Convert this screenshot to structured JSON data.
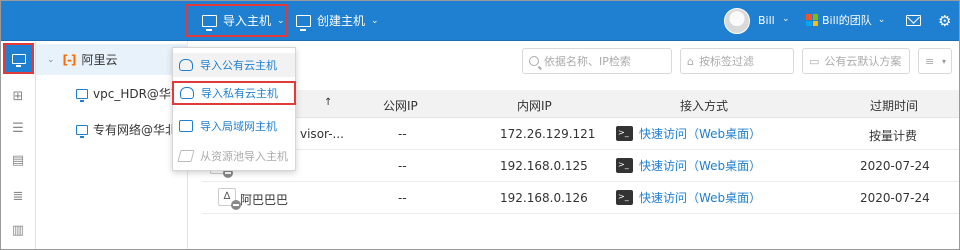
{
  "topbar": {
    "import_label": "导入主机",
    "create_label": "创建主机",
    "user_name": "Bill",
    "team_label": "Bill的团队",
    "brand_color": "#1f7fd0",
    "highlight_color": "#e03a3a"
  },
  "rail": {
    "items": [
      "monitor-icon",
      "topology-icon",
      "database-icon",
      "server-icon",
      "list-icon",
      "clipboard-icon"
    ]
  },
  "tree": {
    "root_label": "阿里云",
    "nodes": [
      "vpc_HDR@华南",
      "专有网络@华北"
    ]
  },
  "filters": {
    "search_placeholder": "依据名称、IP检索",
    "tag_placeholder": "按标签过滤",
    "scheme_value": "公有云默认方案"
  },
  "table": {
    "headers": {
      "name_sort": "↑",
      "public_ip": "公网IP",
      "private_ip": "内网IP",
      "access": "接入方式",
      "expire": "过期时间"
    },
    "rows": [
      {
        "name": "visor-...",
        "public_ip": "--",
        "private_ip": "172.26.129.121",
        "access": "快速访问（Web桌面）",
        "expire": "按量计费"
      },
      {
        "name": "",
        "public_ip": "--",
        "private_ip": "192.168.0.125",
        "access": "快速访问（Web桌面）",
        "expire": "2020-07-24"
      },
      {
        "name": "阿巴巴巴",
        "public_ip": "--",
        "private_ip": "192.168.0.126",
        "access": "快速访问（Web桌面）",
        "expire": "2020-07-24"
      }
    ]
  },
  "menu": {
    "items": [
      {
        "label": "导入公有云主机",
        "state": "hover"
      },
      {
        "label": "导入私有云主机",
        "state": "highlighted"
      },
      {
        "label": "导入局域网主机",
        "state": "normal"
      },
      {
        "label": "从资源池导入主机",
        "state": "disabled"
      }
    ]
  }
}
